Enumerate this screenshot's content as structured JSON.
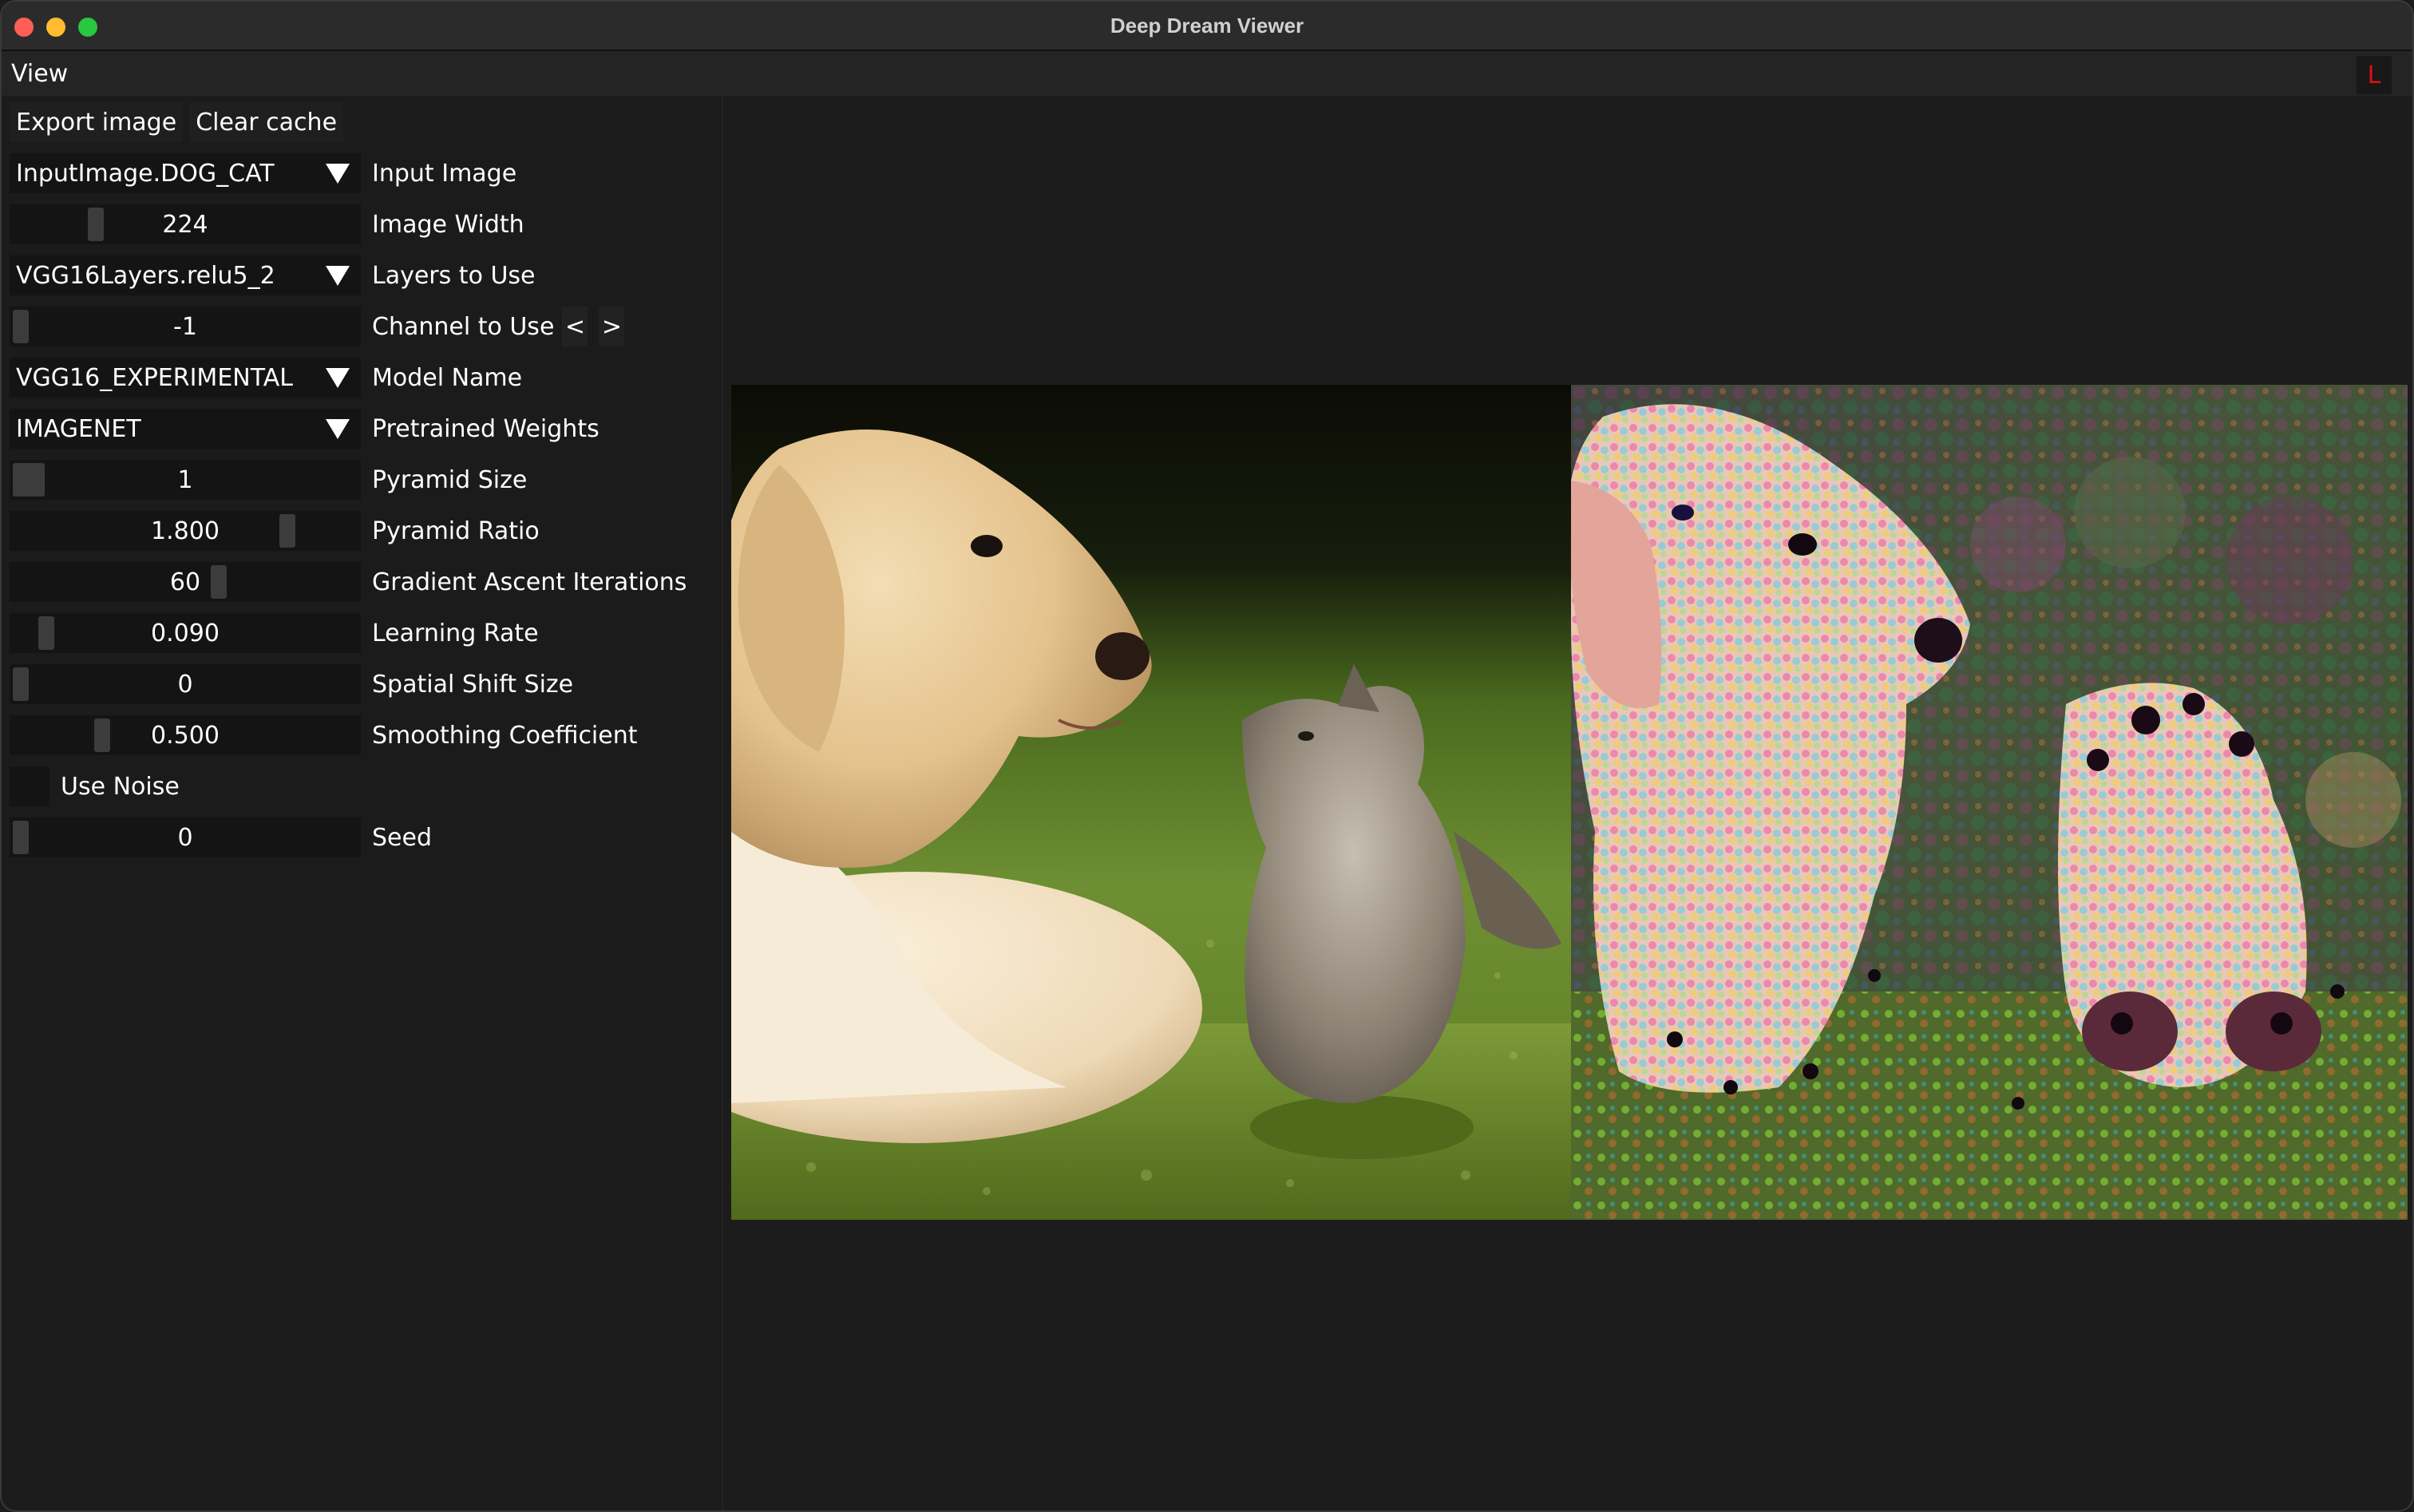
{
  "window": {
    "title": "Deep Dream Viewer"
  },
  "menu": {
    "view": "View",
    "flag": "L"
  },
  "toolbar": {
    "export_label": "Export image",
    "clear_label": "Clear cache"
  },
  "controls": {
    "input_image": {
      "value": "InputImage.DOG_CAT",
      "label": "Input Image"
    },
    "image_width": {
      "value": "224",
      "label": "Image Width"
    },
    "layers": {
      "value": "VGG16Layers.relu5_2",
      "label": "Layers to Use"
    },
    "channel": {
      "value": "-1",
      "label": "Channel to Use",
      "prev": "<",
      "next": ">"
    },
    "model": {
      "value": "VGG16_EXPERIMENTAL",
      "label": "Model Name"
    },
    "weights": {
      "value": "IMAGENET",
      "label": "Pretrained Weights"
    },
    "pyramid_size": {
      "value": "1",
      "label": "Pyramid Size"
    },
    "pyramid_ratio": {
      "value": "1.800",
      "label": "Pyramid Ratio"
    },
    "iterations": {
      "value": "60",
      "label": "Gradient Ascent Iterations"
    },
    "learning_rate": {
      "value": "0.090",
      "label": "Learning Rate"
    },
    "spatial_shift": {
      "value": "0",
      "label": "Spatial Shift Size"
    },
    "smoothing": {
      "value": "0.500",
      "label": "Smoothing Coefficient"
    },
    "use_noise": {
      "label": "Use Noise",
      "checked": false
    },
    "seed": {
      "value": "0",
      "label": "Seed"
    }
  },
  "icons": {
    "dropdown": "triangle-down-icon",
    "window_controls": [
      "close-icon",
      "minimize-icon",
      "maximize-icon"
    ]
  },
  "colors": {
    "accent_flag": "#e01010",
    "panel_bg": "#1b1b1b",
    "field_bg": "#141414",
    "grab": "#3c3c3c"
  },
  "images": {
    "original": "puppy and kitten on grass",
    "dreamed": "deep dream result of puppy and kitten"
  }
}
